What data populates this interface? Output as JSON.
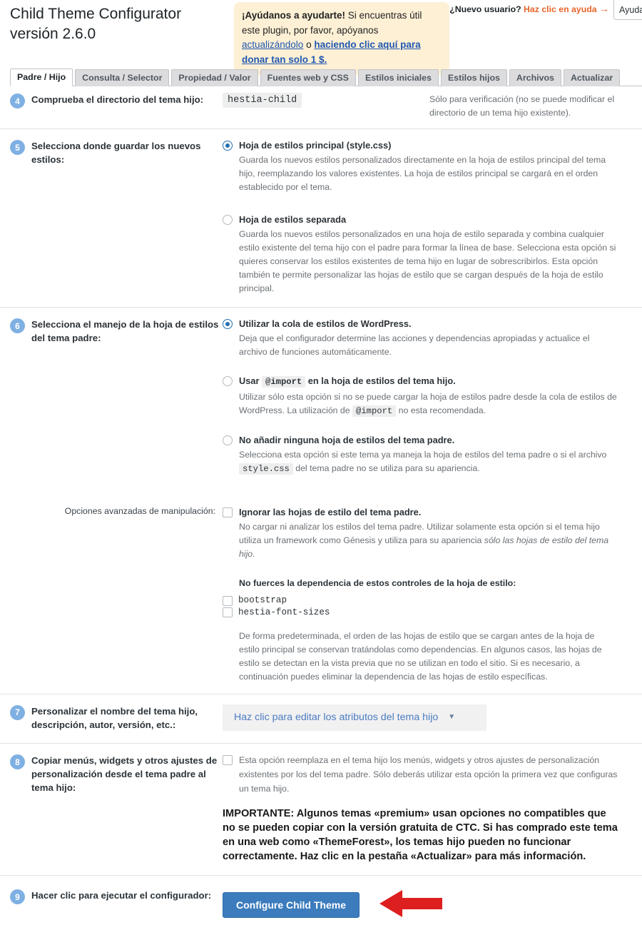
{
  "header": {
    "title": "Child Theme Configurator versión 2.6.0",
    "notice": {
      "strong_lead": "¡Ayúdanos a ayudarte!",
      "text_1": " Si encuentras útil este plugin, por favor, apóyanos ",
      "link_1": "actualizándolo",
      "text_2": " o ",
      "link_2": "haciendo clic aquí para donar tan solo 1 $."
    },
    "new_user_prompt": "¿Nuevo usuario?",
    "new_user_link": "Haz clic en ayuda",
    "new_user_arrow": "→",
    "help_tab_label": "Ayuda"
  },
  "tabs": [
    {
      "label": "Padre / Hijo",
      "active": true
    },
    {
      "label": "Consulta / Selector",
      "active": false
    },
    {
      "label": "Propiedad / Valor",
      "active": false
    },
    {
      "label": "Fuentes web y CSS",
      "active": false
    },
    {
      "label": "Estilos iniciales",
      "active": false
    },
    {
      "label": "Estilos hijos",
      "active": false
    },
    {
      "label": "Archivos",
      "active": false
    },
    {
      "label": "Actualizar",
      "active": false
    }
  ],
  "steps": {
    "s4": {
      "number": "4",
      "label": "Comprueba el directorio del tema hijo:",
      "value": "hestia-child",
      "hint": "Sólo para verificación (no se puede modificar el directorio de un tema hijo existente)."
    },
    "s5": {
      "number": "5",
      "label": "Selecciona donde guardar los nuevos estilos:",
      "options": [
        {
          "title": "Hoja de estilos principal (style.css)",
          "checked": true,
          "desc": "Guarda los nuevos estilos personalizados directamente en la hoja de estilos principal del tema hijo, reemplazando los valores existentes. La hoja de estilos principal se cargará en el orden establecido por el tema."
        },
        {
          "title": "Hoja de estilos separada",
          "checked": false,
          "desc": "Guarda los nuevos estilos personalizados en una hoja de estilo separada y combina cualquier estilo existente del tema hijo con el padre para formar la línea de base. Selecciona esta opción si quieres conservar los estilos existentes de tema hijo en lugar de sobrescribirlos. Esta opción también te permite personalizar las hojas de estilo que se cargan después de la hoja de estilo principal."
        }
      ]
    },
    "s6": {
      "number": "6",
      "label": "Selecciona el manejo de la hoja de estilos del tema padre:",
      "opt1_title": "Utilizar la cola de estilos de WordPress.",
      "opt1_desc": "Deja que el configurador determine las acciones y dependencias apropiadas y actualice el archivo de funciones automáticamente.",
      "opt2_title_a": "Usar",
      "opt2_code": "@import",
      "opt2_title_b": "en la hoja de estilos del tema hijo.",
      "opt2_desc_a": "Utilizar sólo esta opción si no se puede cargar la hoja de estilos padre desde la cola de estilos de WordPress. La utilización de",
      "opt2_desc_code": "@import",
      "opt2_desc_b": "no esta recomendada.",
      "opt3_title": "No añadir ninguna hoja de estilos del tema padre.",
      "opt3_desc_a": "Selecciona esta opción si este tema ya maneja la hoja de estilos del tema padre o si el archivo",
      "opt3_desc_code": "style.css",
      "opt3_desc_b": "del tema padre no se utiliza para su apariencia.",
      "advanced_label": "Opciones avanzadas de manipulación:",
      "adv_check_title": "Ignorar las hojas de estilo del tema padre.",
      "adv_desc_a": "No cargar ni analizar los estilos del tema padre. Utilizar solamente esta opción si el tema hijo utiliza un framework como Génesis y utiliza para su apariencia ",
      "adv_desc_italic": "sólo las hojas de estilo del tema hijo.",
      "deps_heading": "No fuerces la dependencia de estos controles de la hoja de estilo:",
      "deps": [
        "bootstrap",
        "hestia-font-sizes"
      ],
      "deps_desc": "De forma predeterminada, el orden de las hojas de estilo que se cargan antes de la hoja de estilo principal se conservan tratándolas como dependencias. En algunos casos, las hojas de estilo se detectan en la vista previa que no se utilizan en todo el sitio. Si es necesario, a continuación puedes eliminar la dependencia de las hojas de estilo específicas."
    },
    "s7": {
      "number": "7",
      "label": "Personalizar el nombre del tema hijo, descripción, autor, versión, etc.:",
      "toggle_label": "Haz clic para editar los atributos del tema hijo",
      "caret": "▼"
    },
    "s8": {
      "number": "8",
      "label": "Copiar menús, widgets y otros ajustes de personalización desde el tema padre al tema hijo:",
      "checkbox_desc": "Esta opción reemplaza en el tema hijo los menús, widgets y otros ajustes de personalización existentes por los del tema padre. Sólo deberás utilizar esta opción la primera vez que configuras un tema hijo.",
      "important": "IMPORTANTE: Algunos temas «premium» usan opciones no compatibles que no se pueden copiar con la versión gratuita de CTC. Si has comprado este tema en una web como «ThemeForest», los temas hijo pueden no funcionar correctamente. Haz clic en la pestaña «Actualizar» para más información."
    },
    "s9": {
      "number": "9",
      "label": "Hacer clic para ejecutar el configurador:",
      "button_label": "Configure Child Theme"
    }
  },
  "colors": {
    "badge": "#7fb0e3",
    "notice_bg": "#fdf0d5",
    "accent_link": "#e8642b",
    "button": "#3c7cbd",
    "arrow": "#dd1f1f"
  }
}
